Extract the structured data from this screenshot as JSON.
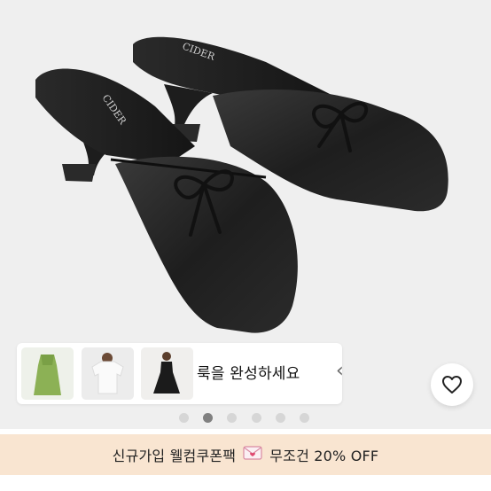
{
  "product": {
    "brand_imprint": "CIDER",
    "photo_label": "black satin square-toe kitten heel mules with bow"
  },
  "look": {
    "title": "룩을 완성하세요",
    "chevron": "‹",
    "thumbnails": [
      "green-slip-dress-icon",
      "white-tshirt-icon",
      "black-dress-icon"
    ]
  },
  "wishlist": {
    "icon": "heart-outline-icon"
  },
  "carousel": {
    "count": 6,
    "active_index": 1
  },
  "banner": {
    "text_left": "신규가입 웰컴쿠폰팩",
    "text_right": "무조건 20% OFF",
    "icon": "envelope-heart-icon"
  },
  "colors": {
    "banner_bg": "#f9e5d1",
    "photo_bg": "#efefef",
    "dot_active": "#808080",
    "dot_inactive": "#d6d6d6"
  }
}
